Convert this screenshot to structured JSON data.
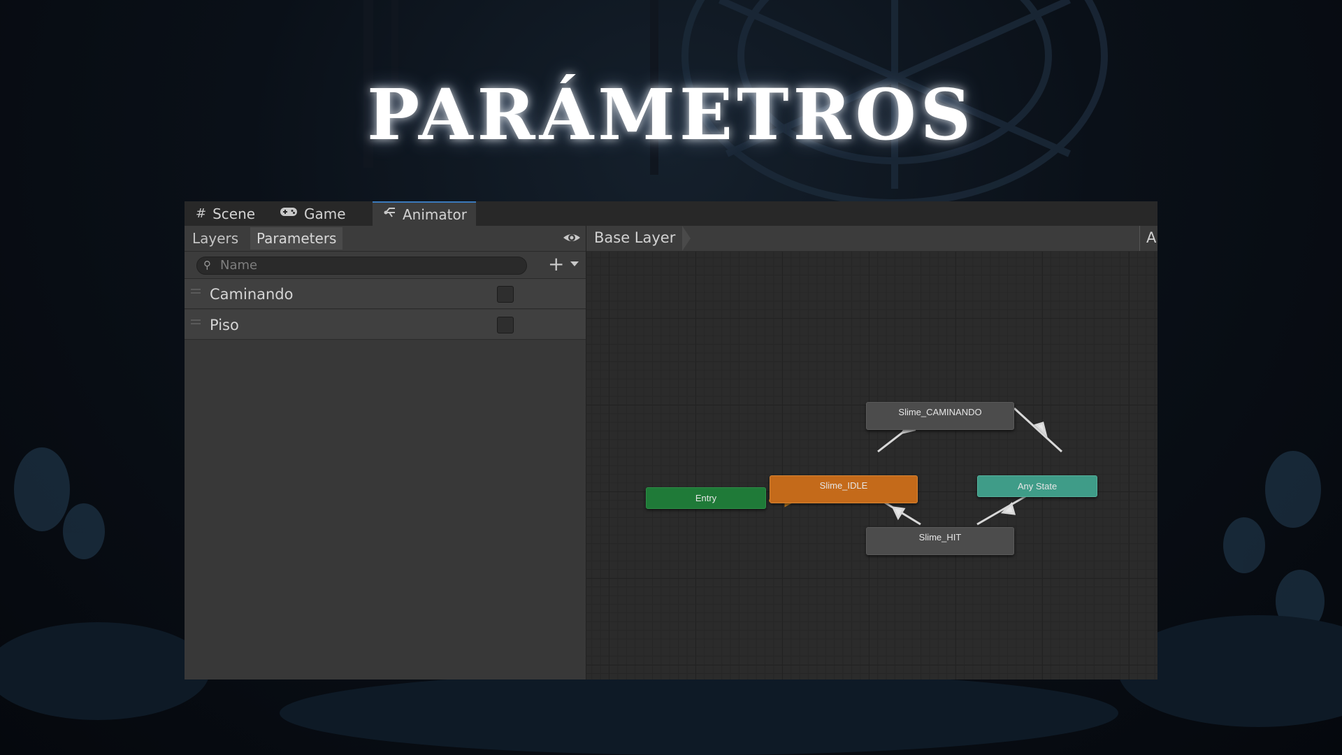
{
  "slide": {
    "title": "PARÁMETROS"
  },
  "editor": {
    "tabs": [
      {
        "label": "Scene",
        "icon": "grid-icon"
      },
      {
        "label": "Game",
        "icon": "gamepad-icon"
      },
      {
        "label": "Animator",
        "icon": "animator-icon",
        "active": true
      }
    ],
    "left_panel": {
      "subtabs": [
        {
          "label": "Layers"
        },
        {
          "label": "Parameters",
          "active": true
        }
      ],
      "search": {
        "placeholder": "Name"
      },
      "add_button": "+",
      "parameters": [
        {
          "name": "Caminando",
          "type": "bool",
          "value": false
        },
        {
          "name": "Piso",
          "type": "bool",
          "value": false
        }
      ]
    },
    "graph": {
      "breadcrumb": "Base Layer",
      "auto_live": "Au",
      "nodes": [
        {
          "id": "caminando",
          "label": "Slime_CAMINANDO",
          "color": "#4c4c4c"
        },
        {
          "id": "entry",
          "label": "Entry",
          "color": "#1f7a38"
        },
        {
          "id": "idle",
          "label": "Slime_IDLE",
          "color": "#c46a1a"
        },
        {
          "id": "any",
          "label": "Any State",
          "color": "#3f9c88"
        },
        {
          "id": "hit",
          "label": "Slime_HIT",
          "color": "#4c4c4c"
        }
      ],
      "transitions": [
        {
          "from": "entry",
          "to": "idle"
        },
        {
          "from": "idle",
          "to": "caminando"
        },
        {
          "from": "any",
          "to": "caminando"
        },
        {
          "from": "hit",
          "to": "idle"
        },
        {
          "from": "hit",
          "to": "any"
        }
      ]
    }
  }
}
